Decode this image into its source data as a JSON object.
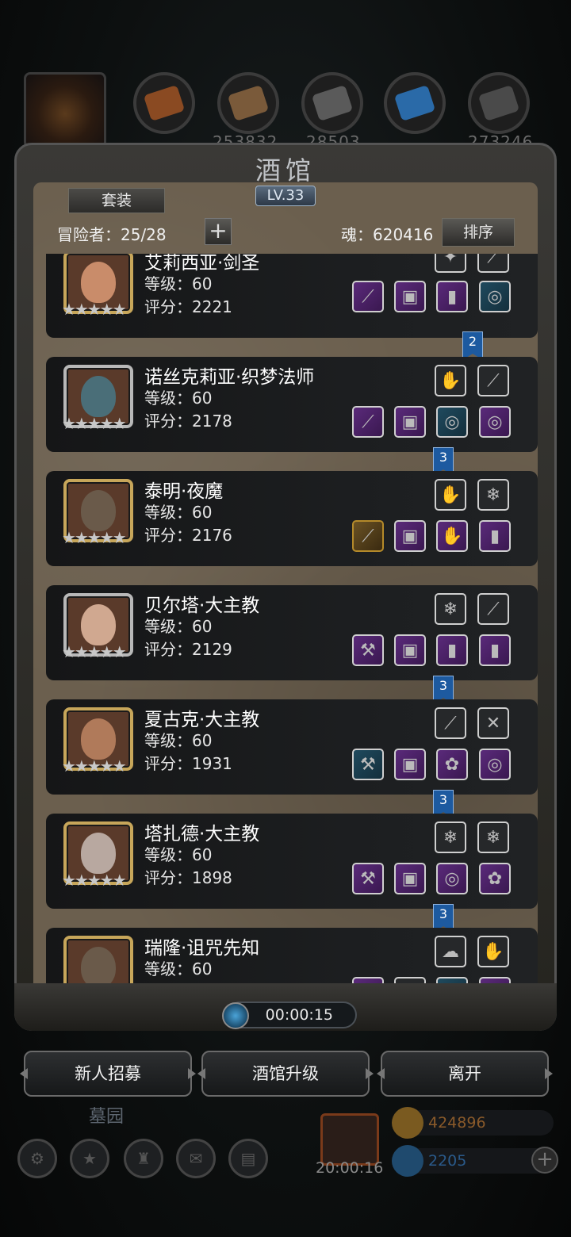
{
  "top_resources": [
    {
      "icon": "meat-icon",
      "value": "",
      "color": "#8a4a22"
    },
    {
      "icon": "wood-icon",
      "value": "253832",
      "color": "#7a5a3a"
    },
    {
      "icon": "stone-icon",
      "value": "28503",
      "color": "#5a5a5a"
    },
    {
      "icon": "crystal-icon",
      "value": "",
      "color": "#2a6aa8"
    },
    {
      "icon": "iron-icon",
      "value": "273246",
      "color": "#4a4a4a"
    }
  ],
  "tavern": {
    "title": "酒馆",
    "level": "LV.33",
    "set_button": "套装",
    "adventurer_label": "冒险者：25/28",
    "plus_label": "+",
    "soul_label": "魂：620416",
    "sort_button": "排序"
  },
  "heroes": [
    {
      "name": "艾莉西亚·剑圣",
      "level": "等级：60",
      "score": "评分：2221",
      "stars": "★★★★★",
      "face": "#c98c6a",
      "ribbon": "2"
    },
    {
      "name": "诺丝克莉亚·织梦法师",
      "level": "等级：60",
      "score": "评分：2178",
      "stars": "★★★★★",
      "face": "#4a6e78",
      "ribbon": "3"
    },
    {
      "name": "泰明·夜魔",
      "level": "等级：60",
      "score": "评分：2176",
      "stars": "★★★★★",
      "face": "#6a5a4a",
      "ribbon": ""
    },
    {
      "name": "贝尔塔·大主教",
      "level": "等级：60",
      "score": "评分：2129",
      "stars": "★★★★★",
      "face": "#d0a890",
      "ribbon": "3"
    },
    {
      "name": "夏古克·大主教",
      "level": "等级：60",
      "score": "评分：1931",
      "stars": "★★★★★",
      "face": "#b07a5a",
      "ribbon": "3"
    },
    {
      "name": "塔扎德·大主教",
      "level": "等级：60",
      "score": "评分：1898",
      "stars": "★★★★★",
      "face": "#b8a8a0",
      "ribbon": "3"
    },
    {
      "name": "瑞隆·诅咒先知",
      "level": "等级：60",
      "score": "",
      "stars": "",
      "face": "#6a5a4a",
      "ribbon": ""
    }
  ],
  "timer": "00:00:15",
  "buttons": {
    "recruit": "新人招募",
    "upgrade": "酒馆升级",
    "leave": "离开"
  },
  "bottom": {
    "area_name": "墓园",
    "gift_timer": "20:00:16",
    "gold": "424896",
    "gems": "2205"
  }
}
